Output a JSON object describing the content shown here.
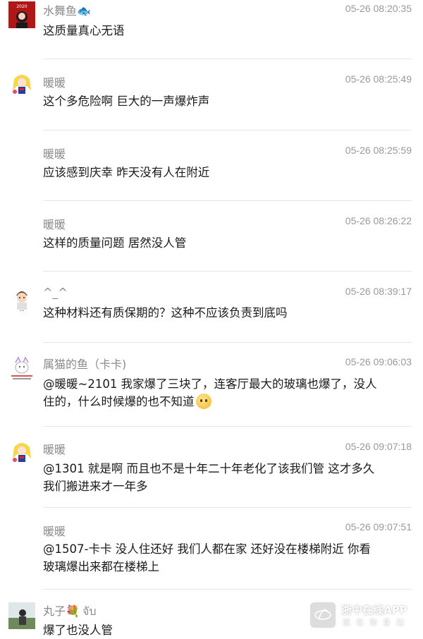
{
  "comments": [
    {
      "user": "水舞鱼",
      "user_emoji": "🐟",
      "time": "05-26 08:20:35",
      "lines": [
        "这质量真心无语"
      ]
    },
    {
      "user": "暖暖",
      "time": "05-26 08:25:49",
      "lines": [
        "这个多危险啊 巨大的一声爆炸声"
      ]
    },
    {
      "user": "暖暖",
      "time": "05-26 08:25:59",
      "lines": [
        "应该感到庆幸 昨天没有人在附近"
      ]
    },
    {
      "user": "暖暖",
      "time": "05-26 08:26:22",
      "lines": [
        "这样的质量问题 居然没人管"
      ]
    },
    {
      "user": "^_^",
      "time": "05-26 08:39:17",
      "lines": [
        "这种材料还有质保期的？这种不应该负责到底吗"
      ]
    },
    {
      "user": "属猫的鱼（卡卡)",
      "time": "05-26 09:06:03",
      "lines": [
        "@暖暖~2101 我家爆了三块了，连客厅最大的玻璃也爆了，没人",
        "住的，什么时候爆的也不知道"
      ],
      "trailing_emoji": "worried-face"
    },
    {
      "user": "暖暖",
      "time": "05-26 09:07:18",
      "lines": [
        "@1301 就是啊 而且也不是十年二十年老化了该我们管 这才多久",
        "我们搬进来才一年多"
      ]
    },
    {
      "user": "暖暖",
      "time": "05-26 09:07:51",
      "lines": [
        "@1507-卡卡 没人住还好 我们人都在家 还好没在楼梯附近 你看",
        "玻璃爆出来都在楼梯上"
      ]
    },
    {
      "user": "丸子",
      "user_emoji": "💐",
      "user_suffix": "จับ",
      "time": "",
      "lines": [
        "爆了也没人管"
      ]
    }
  ],
  "watermark": {
    "title": "浙中在线APP",
    "subtitle": "就在你身边"
  }
}
